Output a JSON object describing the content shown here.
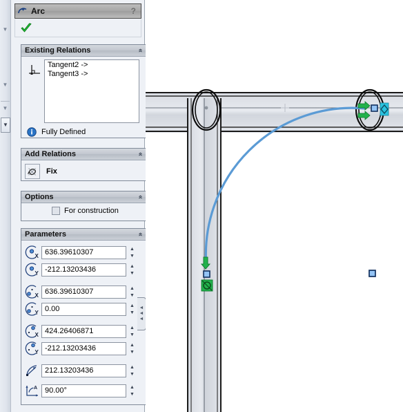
{
  "panel": {
    "title": "Arc",
    "title_icon": "arc-icon",
    "help_label": "?",
    "ok_icon": "green-check-icon",
    "collapse_glyph": "«"
  },
  "existing_relations": {
    "header": "Existing Relations",
    "icon": "perpendicular-relation-icon",
    "items": [
      {
        "label": "Tangent2 ->"
      },
      {
        "label": "Tangent3 ->"
      }
    ],
    "status_icon": "info-icon",
    "status_text": "Fully Defined"
  },
  "add_relations": {
    "header": "Add Relations",
    "fix_icon": "fix-relation-icon",
    "fix_label": "Fix"
  },
  "options": {
    "header": "Options",
    "for_construction_label": "For construction",
    "for_construction_checked": false
  },
  "parameters": {
    "header": "Parameters",
    "rows": [
      {
        "icon": "center-x-icon",
        "value": "636.39610307",
        "group": 0
      },
      {
        "icon": "center-y-icon",
        "value": "-212.13203436",
        "group": 0
      },
      {
        "icon": "start-x-icon",
        "value": "636.39610307",
        "group": 1
      },
      {
        "icon": "start-y-icon",
        "value": "0.00",
        "group": 1
      },
      {
        "icon": "end-x-icon",
        "value": "424.26406871",
        "group": 2
      },
      {
        "icon": "end-y-icon",
        "value": "-212.13203436",
        "group": 2
      },
      {
        "icon": "radius-icon",
        "value": "212.13203436",
        "group": 3
      },
      {
        "icon": "angle-icon",
        "value": "90.00°",
        "group": 4
      }
    ],
    "spin_up_glyph": "▲",
    "spin_down_glyph": "▼"
  },
  "flyout_tab": {
    "name": "panel-flyout-tab",
    "arrow_glyph": "◄"
  },
  "left_gutter": {
    "arrow_glyph": "▼",
    "button_glyph": "▼"
  },
  "colors": {
    "arc_blue": "#5b9bd5",
    "selection_green": "#22b14c",
    "relation_cyan": "#29c3e0",
    "point_blue": "#94c4f5",
    "steel_light": "#e2e5ea",
    "steel_dark": "#1c1c1c",
    "panel_bg": "#eef1f6",
    "titlebar_gray": "#a8a8a8"
  },
  "graphics": {
    "name": "cad-graphics-area",
    "arc_label": "tangent-arc",
    "horizontal_beam": "horizontal-i-beam",
    "vertical_beam": "vertical-i-beam",
    "hole_left": "bolt-hole-left",
    "hole_right": "bolt-hole-right",
    "point_marker": "sketch-point"
  }
}
